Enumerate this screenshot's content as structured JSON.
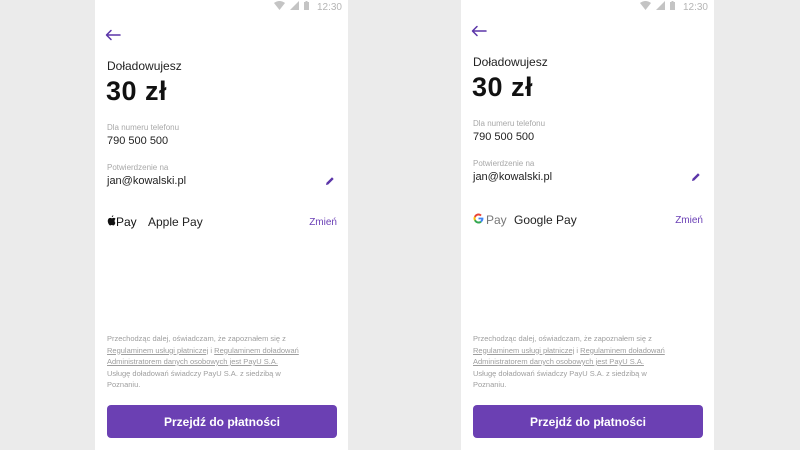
{
  "status_bar": {
    "time": "12:30"
  },
  "colors": {
    "accent": "#6b40b3",
    "link": "#6a3fb5",
    "background": "#ebebeb"
  },
  "screens": [
    {
      "title": "Doładowujesz",
      "amount": "30 zł",
      "phone_label": "Dla numeru telefonu",
      "phone_number": "790 500 500",
      "confirm_label": "Potwierdzenie na",
      "email": "jan@kowalski.pl",
      "payment": {
        "logo_icon": "apple-icon",
        "logo_text": "Pay",
        "name": "Apple Pay",
        "change_label": "Zmień"
      },
      "legal": {
        "line1": "Przechodząc dalej, oświadczam, że zapoznałem się z",
        "link1": "Regulaminem usługi płatniczej",
        "sep": " i ",
        "link2": "Regulaminem doładowań",
        "link3": "Administratorem danych osobowych jest PayU S.A.",
        "line3": "Usługę doładowań świadczy PayU S.A. z siedzibą w",
        "line4": "Poznaniu."
      },
      "cta_label": "Przejdź do płatności"
    },
    {
      "title": "Doładowujesz",
      "amount": "30 zł",
      "phone_label": "Dla numeru telefonu",
      "phone_number": "790 500 500",
      "confirm_label": "Potwierdzenie na",
      "email": "jan@kowalski.pl",
      "payment": {
        "logo_icon": "google-g-icon",
        "logo_text": "Pay",
        "name": "Google Pay",
        "change_label": "Zmień"
      },
      "legal": {
        "line1": "Przechodząc dalej, oświadczam, że zapoznałem się z",
        "link1": "Regulaminem usługi płatniczej",
        "sep": " i ",
        "link2": "Regulaminem doładowań",
        "link3": "Administratorem danych osobowych jest PayU S.A.",
        "line3": "Usługę doładowań świadczy PayU S.A. z siedzibą w",
        "line4": "Poznaniu."
      },
      "cta_label": "Przejdź do płatności"
    }
  ]
}
